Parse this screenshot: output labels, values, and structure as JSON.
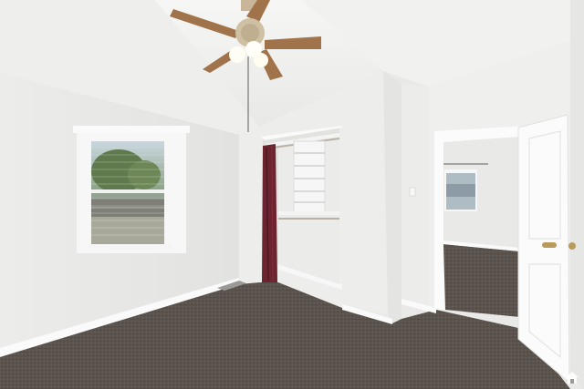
{
  "scene": {
    "description_kind": "real-estate interior photo",
    "colors": {
      "wall": "#efefed",
      "ceiling": "#f3f3f1",
      "carpet": "#5a524c",
      "curtain": "#6b2430",
      "fan_blade": "#a0734a",
      "trim": "#ffffff"
    },
    "icons": {
      "watermark": "home-icon"
    }
  }
}
